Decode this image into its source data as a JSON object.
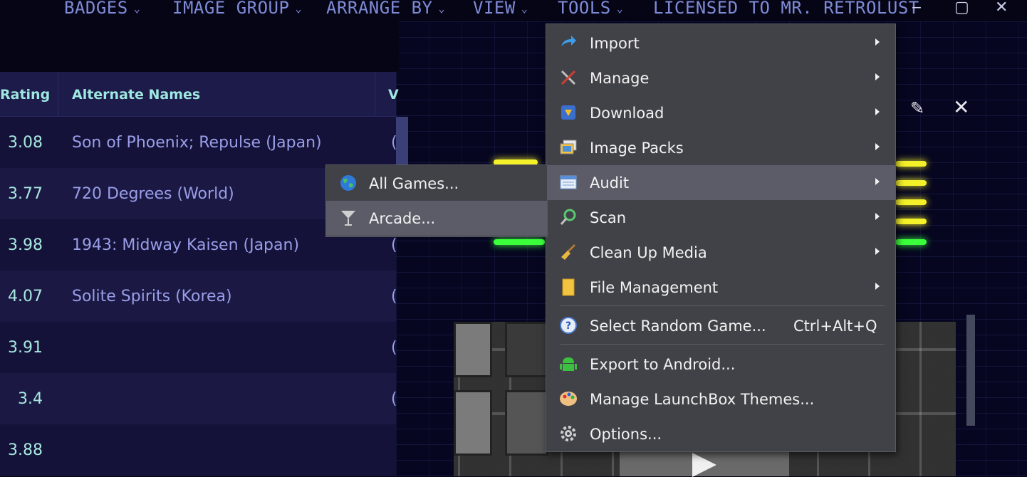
{
  "top_menu": {
    "items": [
      {
        "label": "BADGES",
        "has_chevron": true
      },
      {
        "label": "IMAGE GROUP",
        "has_chevron": true
      },
      {
        "label": "ARRANGE BY",
        "has_chevron": true
      },
      {
        "label": "VIEW",
        "has_chevron": true
      },
      {
        "label": "TOOLS",
        "has_chevron": true
      },
      {
        "label": "LICENSED TO MR. RETROLUST",
        "has_chevron": false
      }
    ],
    "window_controls": {
      "minimize": "‒",
      "maximize": "▢",
      "close": "✕"
    }
  },
  "grid": {
    "columns": {
      "rating": "Rating",
      "alternate_names": "Alternate Names",
      "next_partial": "V"
    },
    "rows": [
      {
        "rating": "3.08",
        "alternate_names": "Son of Phoenix; Repulse (Japan)",
        "partial": "("
      },
      {
        "rating": "3.77",
        "alternate_names": "720 Degrees (World)",
        "partial": ""
      },
      {
        "rating": "3.98",
        "alternate_names": "1943: Midway Kaisen (Japan)",
        "partial": "("
      },
      {
        "rating": "4.07",
        "alternate_names": "Solite Spirits (Korea)",
        "partial": "("
      },
      {
        "rating": "3.91",
        "alternate_names": "",
        "partial": "("
      },
      {
        "rating": "3.4",
        "alternate_names": "",
        "partial": "("
      },
      {
        "rating": "3.88",
        "alternate_names": "",
        "partial": ""
      }
    ]
  },
  "tools_menu": {
    "items": [
      {
        "label": "Import",
        "icon": "import-arrow-icon",
        "submenu": true
      },
      {
        "label": "Manage",
        "icon": "tools-icon",
        "submenu": true
      },
      {
        "label": "Download",
        "icon": "download-icon",
        "submenu": true
      },
      {
        "label": "Image Packs",
        "icon": "image-packs-icon",
        "submenu": true
      },
      {
        "label": "Audit",
        "icon": "audit-icon",
        "submenu": true,
        "active": true
      },
      {
        "label": "Scan",
        "icon": "scan-icon",
        "submenu": true
      },
      {
        "label": "Clean Up Media",
        "icon": "broom-icon",
        "submenu": true
      },
      {
        "label": "File Management",
        "icon": "folder-icon",
        "submenu": true
      },
      {
        "label": "Select Random Game...",
        "icon": "question-icon",
        "shortcut": "Ctrl+Alt+Q"
      },
      {
        "label": "Export to Android...",
        "icon": "android-icon"
      },
      {
        "label": "Manage LaunchBox Themes...",
        "icon": "palette-icon"
      },
      {
        "label": "Options...",
        "icon": "gear-icon"
      }
    ]
  },
  "audit_submenu": {
    "items": [
      {
        "label": "All Games...",
        "icon": "globe-icon"
      },
      {
        "label": "Arcade...",
        "icon": "cocktail-icon",
        "hovered": true
      }
    ]
  },
  "colors": {
    "background": "#050516",
    "grid_bg": "#141238",
    "header_text": "#9fe8e0",
    "alt_name_text": "#9a9ee8",
    "menu_bg": "#414148",
    "menu_active": "#5c5c68",
    "glow_yellow": "#f4f02a",
    "glow_green": "#3cff3c"
  }
}
